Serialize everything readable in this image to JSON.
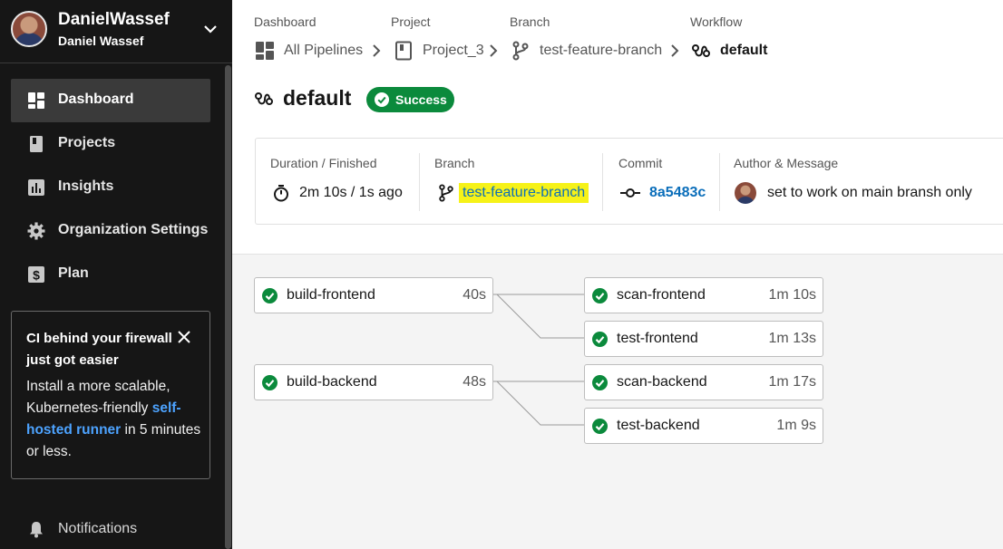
{
  "user": {
    "name": "DanielWassef",
    "subtitle": "Daniel Wassef"
  },
  "sidebar": {
    "items": [
      {
        "label": "Dashboard",
        "icon": "dashboard-icon",
        "active": true
      },
      {
        "label": "Projects",
        "icon": "projects-icon",
        "active": false
      },
      {
        "label": "Insights",
        "icon": "insights-icon",
        "active": false
      },
      {
        "label": "Organization Settings",
        "icon": "gear-icon",
        "active": false
      },
      {
        "label": "Plan",
        "icon": "dollar-icon",
        "active": false
      }
    ],
    "promo": {
      "title": "CI behind your firewall just got easier",
      "body_before": "Install a more scalable, Kubernetes-friendly ",
      "link": "self-hosted runner",
      "body_after": " in 5 minutes or less."
    },
    "notifications": "Notifications"
  },
  "breadcrumb": [
    {
      "heading": "Dashboard",
      "label": "All Pipelines",
      "icon": "dashboard-icon"
    },
    {
      "heading": "Project",
      "label": "Project_3",
      "icon": "project-icon"
    },
    {
      "heading": "Branch",
      "label": "test-feature-branch",
      "icon": "branch-icon"
    },
    {
      "heading": "Workflow",
      "label": "default",
      "icon": "workflow-icon"
    }
  ],
  "workflow": {
    "title": "default",
    "status": "Success",
    "status_color": "#0b8a3c"
  },
  "info": {
    "duration_label": "Duration / Finished",
    "duration_value": "2m 10s / 1s ago",
    "branch_label": "Branch",
    "branch_value": "test-feature-branch",
    "commit_label": "Commit",
    "commit_value": "8a5483c",
    "author_label": "Author & Message",
    "author_message": "set to work on main bransh only"
  },
  "jobs": [
    {
      "name": "build-frontend",
      "time": "40s"
    },
    {
      "name": "scan-frontend",
      "time": "1m 10s"
    },
    {
      "name": "test-frontend",
      "time": "1m 13s"
    },
    {
      "name": "build-backend",
      "time": "48s"
    },
    {
      "name": "scan-backend",
      "time": "1m 17s"
    },
    {
      "name": "test-backend",
      "time": "1m 9s"
    }
  ],
  "colors": {
    "sidebar_bg": "#161616",
    "success": "#0b8a3c",
    "link": "#0b6eba",
    "highlight": "#f6f218"
  }
}
